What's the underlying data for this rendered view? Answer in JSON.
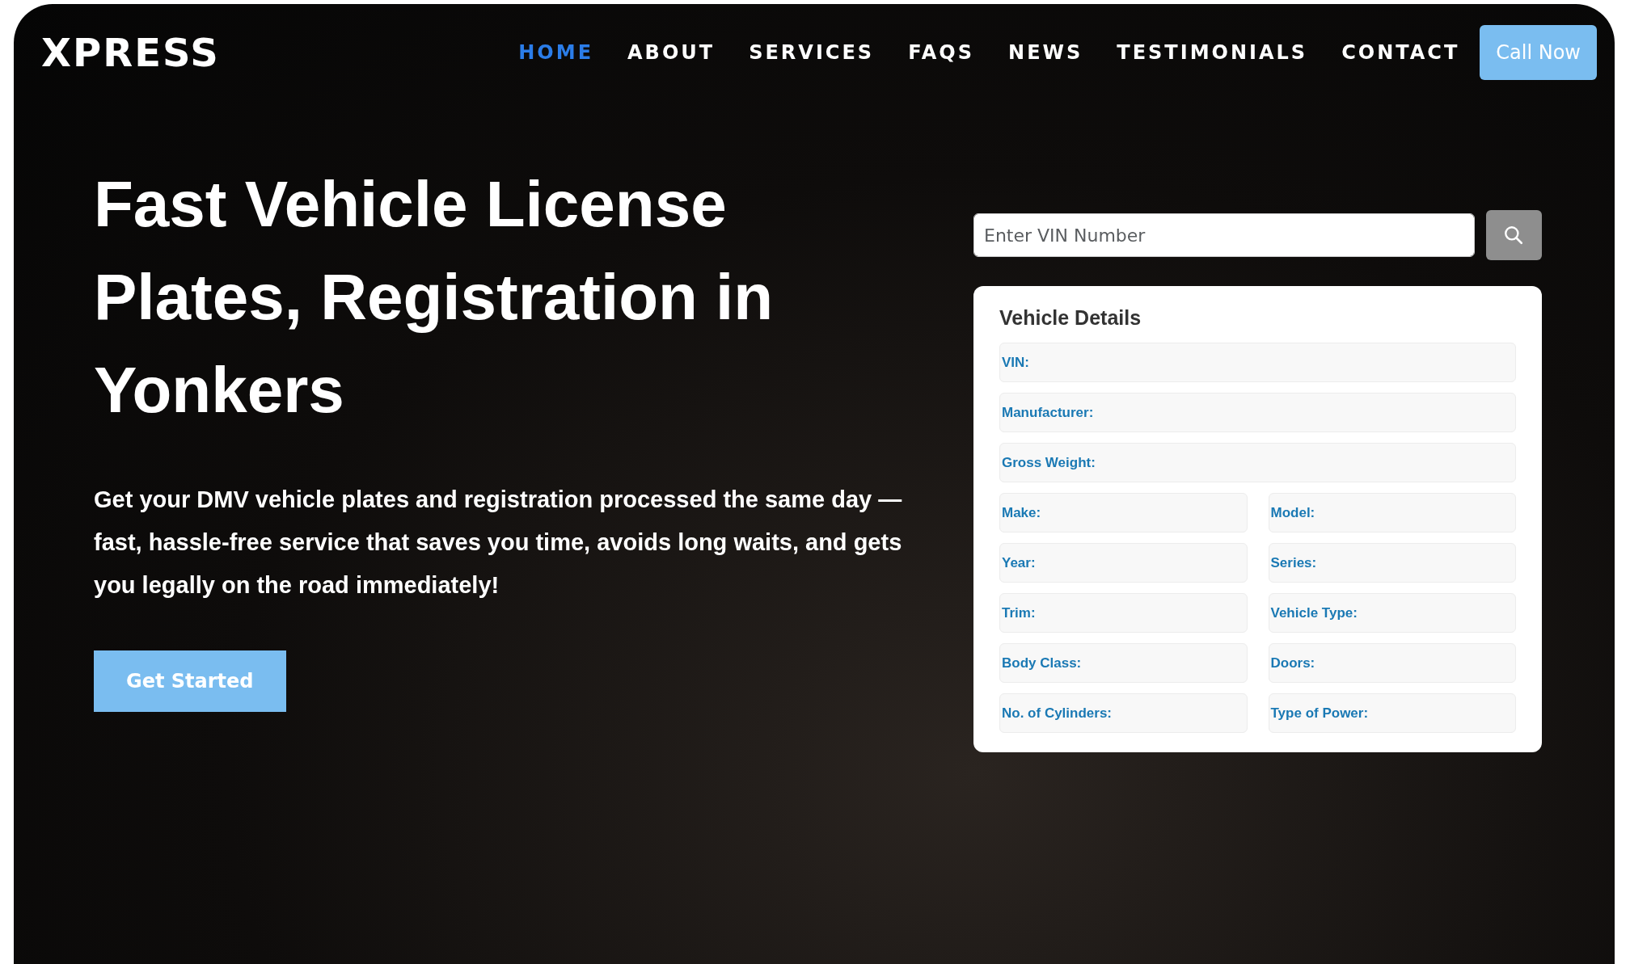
{
  "logo": "XPRESS",
  "nav": [
    {
      "label": "HOME",
      "selected": true
    },
    {
      "label": "ABOUT",
      "selected": false
    },
    {
      "label": "SERVICES",
      "selected": false
    },
    {
      "label": "FAQS",
      "selected": false
    },
    {
      "label": "NEWS",
      "selected": false
    },
    {
      "label": "TESTIMONIALS",
      "selected": false
    },
    {
      "label": "CONTACT",
      "selected": false
    }
  ],
  "call_button": "Call Now",
  "hero": {
    "title": "Fast Vehicle License Plates, Registration in Yonkers",
    "text": "Get your DMV vehicle plates and registration processed the same day — fast, hassle-free service that saves you time, avoids long waits, and gets you legally on the road immediately!",
    "button": "Get Started"
  },
  "vin_search": {
    "placeholder": "Enter VIN Number"
  },
  "vehicle_details": {
    "title": "Vehicle Details",
    "rows": [
      [
        {
          "label": "VIN:"
        }
      ],
      [
        {
          "label": "Manufacturer:"
        }
      ],
      [
        {
          "label": "Gross Weight:"
        }
      ],
      [
        {
          "label": "Make:"
        },
        {
          "label": "Model:"
        }
      ],
      [
        {
          "label": "Year:"
        },
        {
          "label": "Series:"
        }
      ],
      [
        {
          "label": "Trim:"
        },
        {
          "label": "Vehicle Type:"
        }
      ],
      [
        {
          "label": "Body Class:"
        },
        {
          "label": "Doors:"
        }
      ],
      [
        {
          "label": "No. of Cylinders:"
        },
        {
          "label": "Type of Power:"
        }
      ]
    ]
  }
}
